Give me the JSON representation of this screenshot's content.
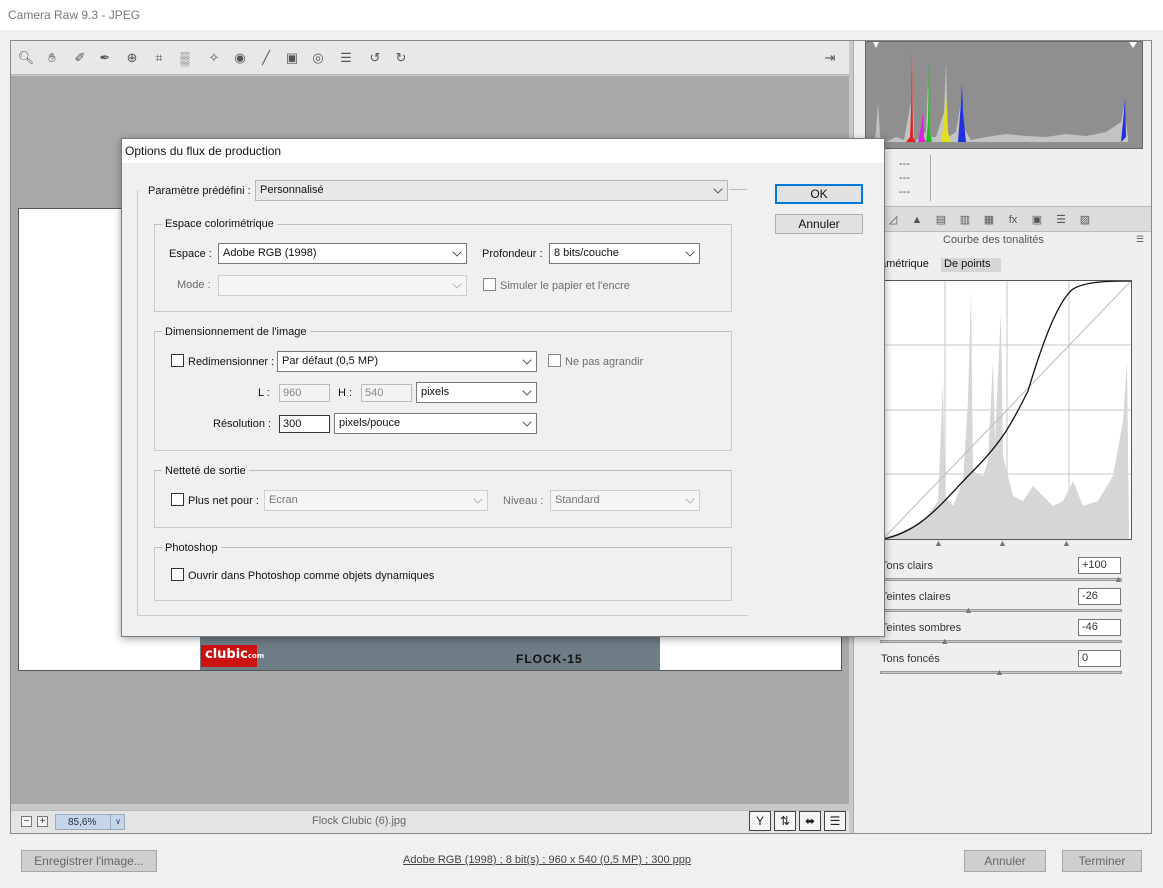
{
  "app": {
    "title": "Camera Raw 9.3  -  JPEG"
  },
  "toolbar": {
    "tools": [
      "zoom-icon",
      "hand-icon",
      "white-balance-icon",
      "color-sampler-icon",
      "targeted-adjust-icon",
      "crop-icon",
      "straighten-icon",
      "spot-removal-icon",
      "red-eye-icon",
      "adjustment-brush-icon",
      "graduated-filter-icon",
      "radial-filter-icon",
      "preferences-icon",
      "rotate-left-icon",
      "rotate-right-icon"
    ],
    "fullscreen_icon": "fullscreen-icon"
  },
  "status": {
    "zoom": "85,6%",
    "filename": "Flock Clubic (6).jpg",
    "logo_text": "clubic",
    "logo_sub": "com",
    "photo_text": "FLOCK-15"
  },
  "histogram": {
    "r": "---",
    "g": "---",
    "b": "---"
  },
  "panel": {
    "title": "Courbe des tonalités",
    "tab_parametric": "amétrique",
    "tab_points": "De points",
    "sliders": [
      {
        "label": "Tons clairs",
        "value": "+100",
        "level": 1.0
      },
      {
        "label": "Teintes claires",
        "value": "-26",
        "level": 0.37
      },
      {
        "label": "Teintes sombres",
        "value": "-46",
        "level": 0.27
      },
      {
        "label": "Tons foncés",
        "value": "0",
        "level": 0.5
      }
    ]
  },
  "footer": {
    "save_label": "Enregistrer l'image...",
    "info": "Adobe RGB (1998) ; 8 bit(s) ; 960 x 540 (0,5 MP) ; 300 ppp",
    "cancel_label": "Annuler",
    "done_label": "Terminer"
  },
  "dialog": {
    "title": "Options du flux de production",
    "preset_label": "Paramètre prédéfini :",
    "preset_value": "Personnalisé",
    "ok_label": "OK",
    "cancel_label": "Annuler",
    "color_space": {
      "legend": "Espace colorimétrique",
      "space_label": "Espace :",
      "space_value": "Adobe RGB (1998)",
      "depth_label": "Profondeur :",
      "depth_value": "8 bits/couche",
      "mode_label": "Mode :",
      "simulate_label": "Simuler le papier et l'encre"
    },
    "sizing": {
      "legend": "Dimensionnement de l'image",
      "resize_label": "Redimensionner :",
      "resize_value": "Par défaut (0,5 MP)",
      "no_enlarge_label": "Ne pas agrandir",
      "w_label": "L :",
      "w_value": "960",
      "h_label": "H :",
      "h_value": "540",
      "unit_value": "pixels",
      "res_label": "Résolution :",
      "res_value": "300",
      "res_unit_value": "pixels/pouce"
    },
    "sharpen": {
      "legend": "Netteté de sortie",
      "sharpen_label": "Plus net pour :",
      "sharpen_value": "Ecran",
      "level_label": "Niveau :",
      "level_value": "Standard"
    },
    "photoshop": {
      "legend": "Photoshop",
      "smart_label": "Ouvrir dans Photoshop comme objets dynamiques"
    }
  }
}
